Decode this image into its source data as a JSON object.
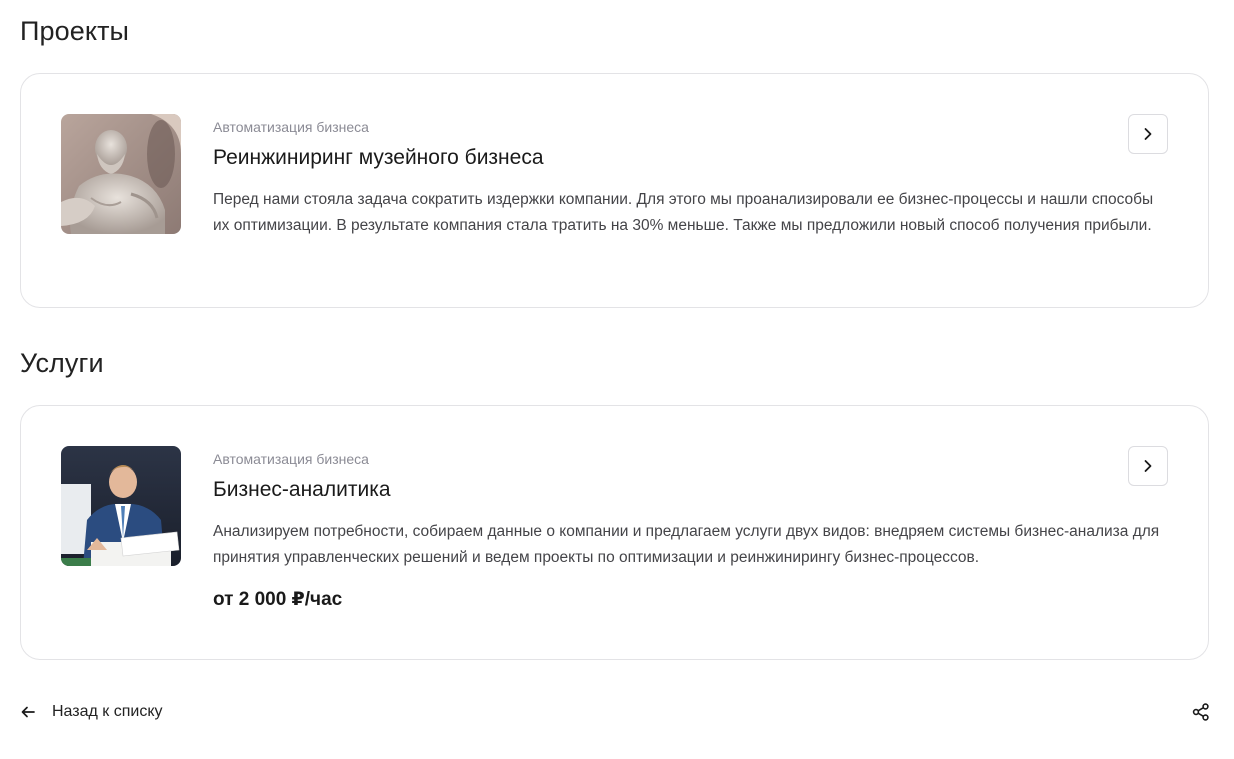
{
  "projects": {
    "section_title": "Проекты",
    "card": {
      "category": "Автоматизация бизнеса",
      "title": "Реинжиниринг музейного бизнеса",
      "description": "Перед нами стояла задача сократить издержки компании. Для этого мы проанализировали ее бизнес-процессы и нашли способы их оптимизации. В результате компания стала тратить на 30% меньше. Также мы предложили новый способ получения прибыли.",
      "image_icon": "sculpture-photo"
    }
  },
  "services": {
    "section_title": "Услуги",
    "card": {
      "category": "Автоматизация бизнеса",
      "title": "Бизнес-аналитика",
      "description": "Анализируем потребности, собираем данные о компании и предлагаем услуги двух видов: внедряем системы бизнес-анализа для принятия управленческих решений и ведем проекты по оптимизации и реинжинирингу бизнес-процессов.",
      "price": "от 2 000 ₽/час",
      "image_icon": "businessman-photo"
    }
  },
  "footer": {
    "back_label": "Назад к списку",
    "back_icon": "arrow-left-icon",
    "share_icon": "share-icon"
  },
  "colors": {
    "border": "#e3e3e6",
    "muted_text": "#8b8b95",
    "body_text": "#444448"
  }
}
